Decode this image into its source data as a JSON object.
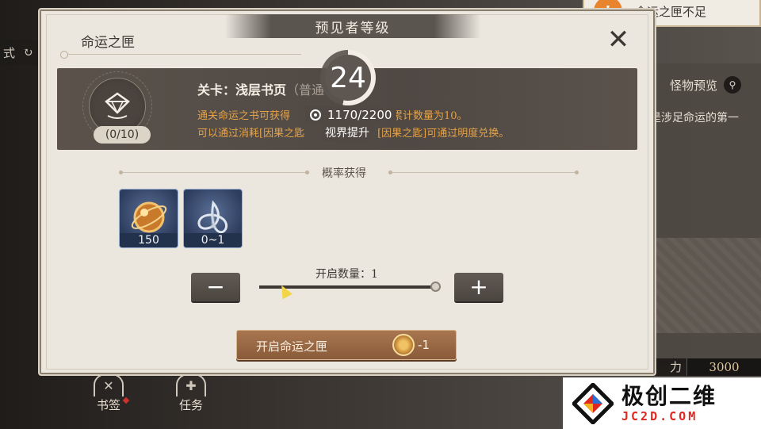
{
  "background": {
    "left_fragment_text": "式",
    "toast_text": "命运之匣不足",
    "monster_preview": "怪物预览",
    "description_snippet": "是涉足命运的第一",
    "power_label": "力",
    "power_value": "3000",
    "nav": [
      {
        "label": "书签"
      },
      {
        "label": "任务"
      }
    ]
  },
  "modal": {
    "title": "命运之匣",
    "seer_level_title": "预见者等级",
    "seer_level": "24",
    "seer_progress_fraction": 0.53,
    "box_count": "(0/10)",
    "stage_label": "关卡：浅层书页",
    "stage_suffix": "（普通",
    "info_line1": "通关命运之书可获得",
    "info_line1_tail": "匣累计数量为10。",
    "info_line2": "可以通过消耗[因果之匙",
    "info_line2_tail": "励。[因果之匙]可通过明度兑换。",
    "vision_progress": "1170/2200",
    "vision_up": "视界提升",
    "probability_title": "概率获得",
    "items": [
      {
        "name": "orb-item",
        "quantity": "150"
      },
      {
        "name": "triquetra-item",
        "quantity": "0~1"
      }
    ],
    "open_quantity_label": "开启数量：1",
    "slider_fraction": 1.0,
    "minus_label": "−",
    "plus_label": "+",
    "open_button_label": "开启命运之匣",
    "open_cost": "-1"
  },
  "watermark": {
    "big": "极创二维",
    "small": "JC2D.COM"
  }
}
